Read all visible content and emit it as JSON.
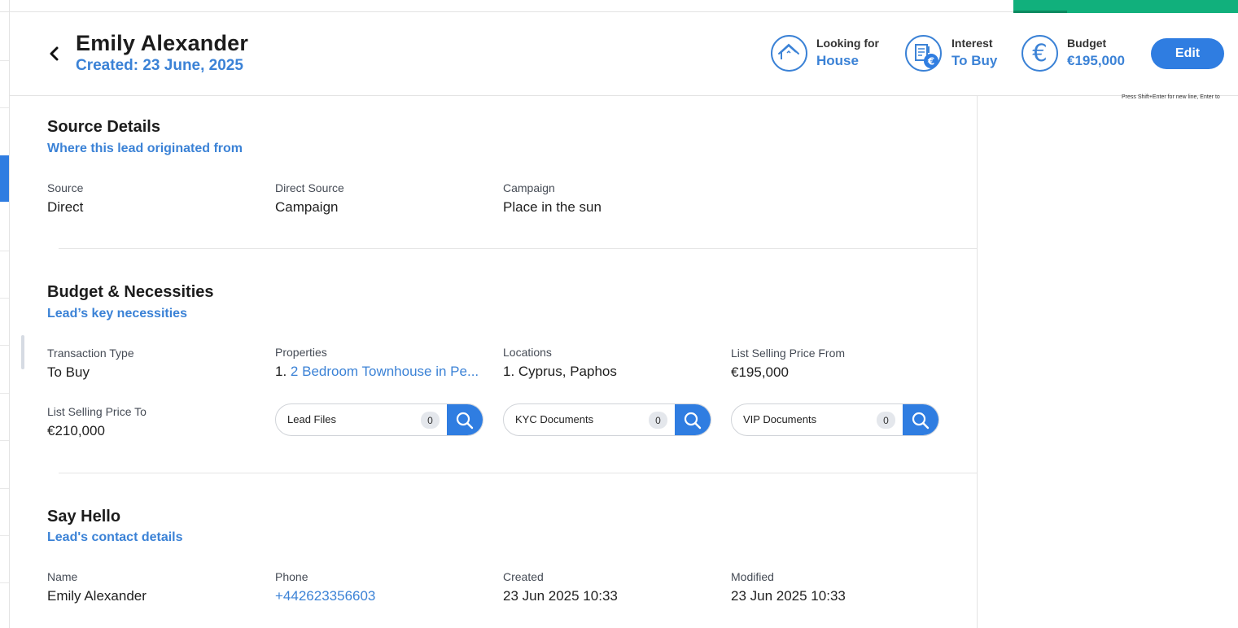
{
  "header": {
    "title": "Emily Alexander",
    "created": "Created: 23 June, 2025",
    "looking_for": {
      "label": "Looking for",
      "value": "House",
      "icon": "house-icon"
    },
    "interest": {
      "label": "Interest",
      "value": "To Buy",
      "icon": "building-euro-icon"
    },
    "budget": {
      "label": "Budget",
      "value": "€195,000",
      "icon": "euro-icon"
    },
    "edit_label": "Edit"
  },
  "hint": "Press Shift+Enter for new line, Enter to",
  "source_details": {
    "title": "Source Details",
    "subtitle": "Where this lead originated from",
    "fields": [
      {
        "label": "Source",
        "value": "Direct"
      },
      {
        "label": "Direct Source",
        "value": "Campaign"
      },
      {
        "label": "Campaign",
        "value": "Place in the sun"
      }
    ]
  },
  "budget_necessities": {
    "title": "Budget & Necessities",
    "subtitle": "Lead’s key necessities",
    "transaction_type": {
      "label": "Transaction Type",
      "value": "To Buy"
    },
    "properties": {
      "label": "Properties",
      "index": "1.",
      "value": "2 Bedroom Townhouse in Pe..."
    },
    "locations": {
      "label": "Locations",
      "value": "1. Cyprus, Paphos"
    },
    "price_from": {
      "label": "List Selling Price From",
      "value": "€195,000"
    },
    "price_to": {
      "label": "List Selling Price To",
      "value": "€210,000"
    },
    "documents": [
      {
        "label": "Lead Files",
        "count": "0"
      },
      {
        "label": "KYC Documents",
        "count": "0"
      },
      {
        "label": "VIP Documents",
        "count": "0"
      }
    ]
  },
  "say_hello": {
    "title": "Say Hello",
    "subtitle": "Lead's contact details",
    "fields": [
      {
        "label": "Name",
        "value": "Emily Alexander"
      },
      {
        "label": "Phone",
        "value": "+442623356603"
      },
      {
        "label": "Created",
        "value": "23 Jun 2025 10:33"
      },
      {
        "label": "Modified",
        "value": "23 Jun 2025 10:33"
      }
    ]
  },
  "colors": {
    "accent": "#2f7de1",
    "link": "#3b82d6",
    "green": "#11b07c"
  }
}
